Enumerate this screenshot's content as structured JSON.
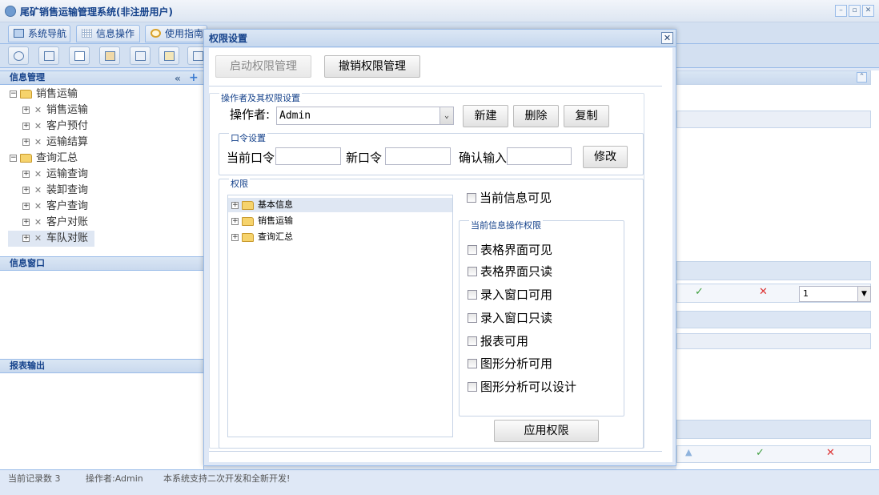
{
  "app": {
    "title": "尾矿销售运输管理系统(非注册用户)",
    "tabs": [
      "系统导航",
      "信息操作",
      "使用指南"
    ],
    "toolbar_icons": [
      "search-icon",
      "table-icon",
      "page-icon",
      "user-icon",
      "window-icon",
      "export-icon",
      "print-icon"
    ]
  },
  "left": {
    "info_header": "信息管理",
    "tree": [
      {
        "label": "销售运输",
        "kind": "folder"
      },
      {
        "label": "销售运输",
        "kind": "tool"
      },
      {
        "label": "客户预付",
        "kind": "tool"
      },
      {
        "label": "运输结算",
        "kind": "tool"
      },
      {
        "label": "查询汇总",
        "kind": "folder"
      },
      {
        "label": "运输查询",
        "kind": "tool"
      },
      {
        "label": "装卸查询",
        "kind": "tool"
      },
      {
        "label": "客户查询",
        "kind": "tool"
      },
      {
        "label": "客户对账",
        "kind": "tool"
      },
      {
        "label": "车队对账",
        "kind": "tool"
      }
    ],
    "window_header": "信息窗口",
    "report_header": "报表输出"
  },
  "right": {
    "page_value": "1"
  },
  "status": {
    "records": "当前记录数 3",
    "operator": "操作者:Admin",
    "note": "本系统支持二次开发和全新开发!"
  },
  "dialog": {
    "title": "权限设置",
    "enable_btn": "启动权限管理",
    "revoke_btn": "撤销权限管理",
    "operator_section": "操作者及其权限设置",
    "operator_label": "操作者:",
    "operator_value": "Admin",
    "new_btn": "新建",
    "delete_btn": "删除",
    "copy_btn": "复制",
    "password_section": "口令设置",
    "current_pwd_label": "当前口令",
    "new_pwd_label": "新口令",
    "confirm_label": "确认输入",
    "current_pwd": "",
    "new_pwd": "",
    "confirm_pwd": "",
    "modify_btn": "修改",
    "perm_section": "权限",
    "perm_tree": [
      "基本信息",
      "销售运输",
      "查询汇总"
    ],
    "current_visible": "当前信息可见",
    "op_section": "当前信息操作权限",
    "op_perms": [
      "表格界面可见",
      "表格界面只读",
      "录入窗口可用",
      "录入窗口只读",
      "报表可用",
      "图形分析可用",
      "图形分析可以设计"
    ],
    "apply_btn": "应用权限"
  }
}
